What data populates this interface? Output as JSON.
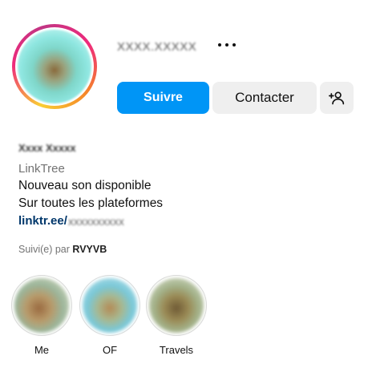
{
  "profile": {
    "username": "XXXX.XXXXX",
    "display_name": "Xxxx Xxxxx",
    "category": "LinkTree",
    "bio_lines": [
      "Nouveau son disponible",
      "Sur toutes les plateformes"
    ],
    "link_prefix": "linktr.ee/",
    "link_blurred": "xxxxxxxxxx",
    "followed_by_prefix": "Suivi(e) par",
    "followed_by_user": "RVYVB"
  },
  "actions": {
    "follow_label": "Suivre",
    "contact_label": "Contacter",
    "more_icon": "more-horizontal-icon",
    "suggest_icon": "add-person-icon"
  },
  "highlights": [
    {
      "label": "Me"
    },
    {
      "label": "OF"
    },
    {
      "label": "Travels"
    }
  ],
  "colors": {
    "accent": "#0095f6",
    "secondary_button": "#efefef",
    "link": "#00376b",
    "muted_text": "#737373"
  }
}
